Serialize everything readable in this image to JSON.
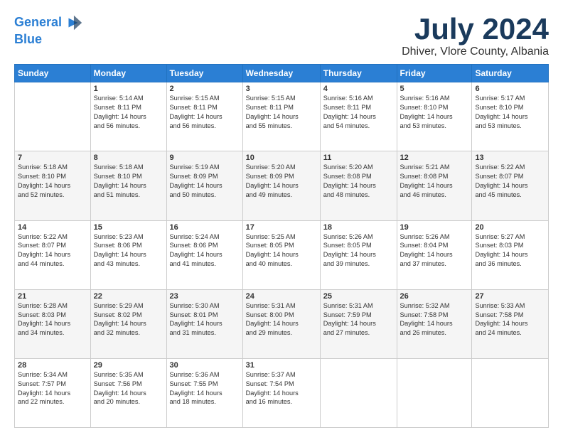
{
  "logo": {
    "line1": "General",
    "line2": "Blue"
  },
  "title": "July 2024",
  "location": "Dhiver, Vlore County, Albania",
  "days_of_week": [
    "Sunday",
    "Monday",
    "Tuesday",
    "Wednesday",
    "Thursday",
    "Friday",
    "Saturday"
  ],
  "weeks": [
    [
      {
        "day": "",
        "content": ""
      },
      {
        "day": "1",
        "content": "Sunrise: 5:14 AM\nSunset: 8:11 PM\nDaylight: 14 hours\nand 56 minutes."
      },
      {
        "day": "2",
        "content": "Sunrise: 5:15 AM\nSunset: 8:11 PM\nDaylight: 14 hours\nand 56 minutes."
      },
      {
        "day": "3",
        "content": "Sunrise: 5:15 AM\nSunset: 8:11 PM\nDaylight: 14 hours\nand 55 minutes."
      },
      {
        "day": "4",
        "content": "Sunrise: 5:16 AM\nSunset: 8:11 PM\nDaylight: 14 hours\nand 54 minutes."
      },
      {
        "day": "5",
        "content": "Sunrise: 5:16 AM\nSunset: 8:10 PM\nDaylight: 14 hours\nand 53 minutes."
      },
      {
        "day": "6",
        "content": "Sunrise: 5:17 AM\nSunset: 8:10 PM\nDaylight: 14 hours\nand 53 minutes."
      }
    ],
    [
      {
        "day": "7",
        "content": "Sunrise: 5:18 AM\nSunset: 8:10 PM\nDaylight: 14 hours\nand 52 minutes."
      },
      {
        "day": "8",
        "content": "Sunrise: 5:18 AM\nSunset: 8:10 PM\nDaylight: 14 hours\nand 51 minutes."
      },
      {
        "day": "9",
        "content": "Sunrise: 5:19 AM\nSunset: 8:09 PM\nDaylight: 14 hours\nand 50 minutes."
      },
      {
        "day": "10",
        "content": "Sunrise: 5:20 AM\nSunset: 8:09 PM\nDaylight: 14 hours\nand 49 minutes."
      },
      {
        "day": "11",
        "content": "Sunrise: 5:20 AM\nSunset: 8:08 PM\nDaylight: 14 hours\nand 48 minutes."
      },
      {
        "day": "12",
        "content": "Sunrise: 5:21 AM\nSunset: 8:08 PM\nDaylight: 14 hours\nand 46 minutes."
      },
      {
        "day": "13",
        "content": "Sunrise: 5:22 AM\nSunset: 8:07 PM\nDaylight: 14 hours\nand 45 minutes."
      }
    ],
    [
      {
        "day": "14",
        "content": "Sunrise: 5:22 AM\nSunset: 8:07 PM\nDaylight: 14 hours\nand 44 minutes."
      },
      {
        "day": "15",
        "content": "Sunrise: 5:23 AM\nSunset: 8:06 PM\nDaylight: 14 hours\nand 43 minutes."
      },
      {
        "day": "16",
        "content": "Sunrise: 5:24 AM\nSunset: 8:06 PM\nDaylight: 14 hours\nand 41 minutes."
      },
      {
        "day": "17",
        "content": "Sunrise: 5:25 AM\nSunset: 8:05 PM\nDaylight: 14 hours\nand 40 minutes."
      },
      {
        "day": "18",
        "content": "Sunrise: 5:26 AM\nSunset: 8:05 PM\nDaylight: 14 hours\nand 39 minutes."
      },
      {
        "day": "19",
        "content": "Sunrise: 5:26 AM\nSunset: 8:04 PM\nDaylight: 14 hours\nand 37 minutes."
      },
      {
        "day": "20",
        "content": "Sunrise: 5:27 AM\nSunset: 8:03 PM\nDaylight: 14 hours\nand 36 minutes."
      }
    ],
    [
      {
        "day": "21",
        "content": "Sunrise: 5:28 AM\nSunset: 8:03 PM\nDaylight: 14 hours\nand 34 minutes."
      },
      {
        "day": "22",
        "content": "Sunrise: 5:29 AM\nSunset: 8:02 PM\nDaylight: 14 hours\nand 32 minutes."
      },
      {
        "day": "23",
        "content": "Sunrise: 5:30 AM\nSunset: 8:01 PM\nDaylight: 14 hours\nand 31 minutes."
      },
      {
        "day": "24",
        "content": "Sunrise: 5:31 AM\nSunset: 8:00 PM\nDaylight: 14 hours\nand 29 minutes."
      },
      {
        "day": "25",
        "content": "Sunrise: 5:31 AM\nSunset: 7:59 PM\nDaylight: 14 hours\nand 27 minutes."
      },
      {
        "day": "26",
        "content": "Sunrise: 5:32 AM\nSunset: 7:58 PM\nDaylight: 14 hours\nand 26 minutes."
      },
      {
        "day": "27",
        "content": "Sunrise: 5:33 AM\nSunset: 7:58 PM\nDaylight: 14 hours\nand 24 minutes."
      }
    ],
    [
      {
        "day": "28",
        "content": "Sunrise: 5:34 AM\nSunset: 7:57 PM\nDaylight: 14 hours\nand 22 minutes."
      },
      {
        "day": "29",
        "content": "Sunrise: 5:35 AM\nSunset: 7:56 PM\nDaylight: 14 hours\nand 20 minutes."
      },
      {
        "day": "30",
        "content": "Sunrise: 5:36 AM\nSunset: 7:55 PM\nDaylight: 14 hours\nand 18 minutes."
      },
      {
        "day": "31",
        "content": "Sunrise: 5:37 AM\nSunset: 7:54 PM\nDaylight: 14 hours\nand 16 minutes."
      },
      {
        "day": "",
        "content": ""
      },
      {
        "day": "",
        "content": ""
      },
      {
        "day": "",
        "content": ""
      }
    ]
  ]
}
